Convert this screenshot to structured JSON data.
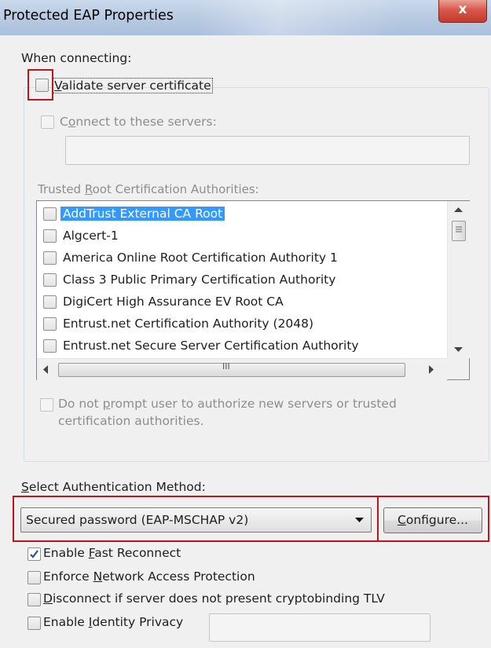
{
  "window": {
    "title": "Protected EAP Properties",
    "close_glyph": "x"
  },
  "when_connecting": {
    "label": "When connecting:",
    "validate_cert": {
      "label": "Validate server certificate",
      "mnemonic": "V",
      "rest": "alidate server certificate",
      "checked": false
    },
    "connect_servers": {
      "label": "Connect to these servers:",
      "pre": "C",
      "mnemonic": "o",
      "rest": "nnect to these servers:",
      "checked": false,
      "enabled": false
    },
    "servers_input": {
      "value": ""
    }
  },
  "trusted_roots": {
    "label": "Trusted Root Certification Authorities:",
    "pre": "Trusted ",
    "mnemonic": "R",
    "rest": "oot Certification Authorities:",
    "items": [
      {
        "label": "AddTrust External CA Root",
        "checked": false,
        "selected": true
      },
      {
        "label": "Algcert-1",
        "checked": false,
        "selected": false
      },
      {
        "label": "America Online Root Certification Authority 1",
        "checked": false,
        "selected": false
      },
      {
        "label": "Class 3 Public Primary Certification Authority",
        "checked": false,
        "selected": false
      },
      {
        "label": "DigiCert High Assurance EV Root CA",
        "checked": false,
        "selected": false
      },
      {
        "label": "Entrust.net Certification Authority (2048)",
        "checked": false,
        "selected": false
      },
      {
        "label": "Entrust.net Secure Server Certification Authority",
        "checked": false,
        "selected": false
      }
    ],
    "hscroll_grip": "III"
  },
  "no_prompt": {
    "line1_pre": "Do not ",
    "mnemonic": "p",
    "line1_rest": "rompt user to authorize new servers or trusted",
    "line2": "certification authorities.",
    "checked": false,
    "enabled": false
  },
  "auth_method": {
    "label_mnemonic": "S",
    "label_rest": "elect Authentication Method:",
    "selected": "Secured password (EAP-MSCHAP v2)",
    "configure_mnemonic": "C",
    "configure_rest": "onfigure..."
  },
  "options": {
    "fast_reconnect": {
      "pre": "Enable ",
      "mnemonic": "F",
      "rest": "ast Reconnect",
      "checked": true
    },
    "nap": {
      "pre": "Enforce ",
      "mnemonic": "N",
      "rest": "etwork Access Protection",
      "checked": false
    },
    "cryptobinding": {
      "pre": "",
      "mnemonic": "D",
      "rest": "isconnect if server does not present cryptobinding TLV",
      "checked": false
    },
    "identity_privacy": {
      "pre": "Enable ",
      "mnemonic": "I",
      "rest": "dentity Privacy",
      "checked": false
    },
    "identity_input": {
      "value": ""
    }
  },
  "colors": {
    "highlight_box": "#c0141c",
    "selection": "#3399ff",
    "check": "#2a4f8f"
  }
}
